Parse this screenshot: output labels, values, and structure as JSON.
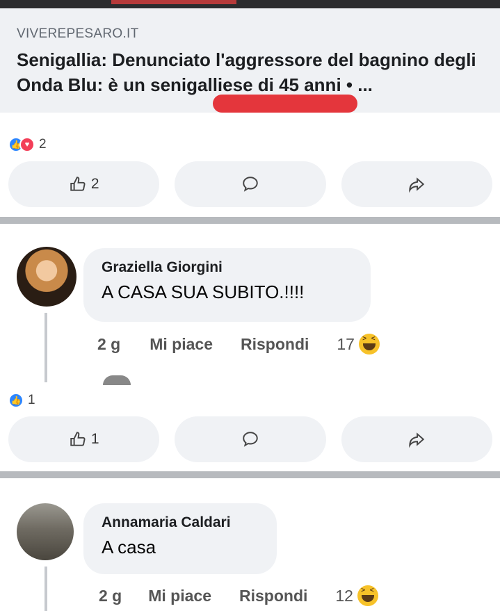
{
  "link_preview": {
    "source": "VIVEREPESARO.IT",
    "title": "Senigallia: Denunciato l'aggressore del bagnino degli Onda Blu: è un senigalliese di 45 anni • ..."
  },
  "post1": {
    "reaction_count": "2",
    "like_count": "2"
  },
  "comment1": {
    "author": "Graziella Giorgini",
    "text": "A CASA SUA SUBITO.!!!!",
    "age": "2 g",
    "like_label": "Mi piace",
    "reply_label": "Rispondi",
    "reaction_count": "17"
  },
  "post2": {
    "reaction_count": "1",
    "like_count": "1"
  },
  "comment2": {
    "author": "Annamaria Caldari",
    "text": "A casa",
    "age": "2 g",
    "like_label": "Mi piace",
    "reply_label": "Rispondi",
    "reaction_count": "12"
  },
  "colors": {
    "like_blue": "#2d86ff",
    "love_red": "#f33e58",
    "highlight_red": "#e3262b",
    "bubble_gray": "#f0f2f5"
  },
  "icons": [
    "thumbs-up-icon",
    "comment-icon",
    "share-icon",
    "like-reaction-icon",
    "love-reaction-icon",
    "haha-reaction-icon"
  ]
}
